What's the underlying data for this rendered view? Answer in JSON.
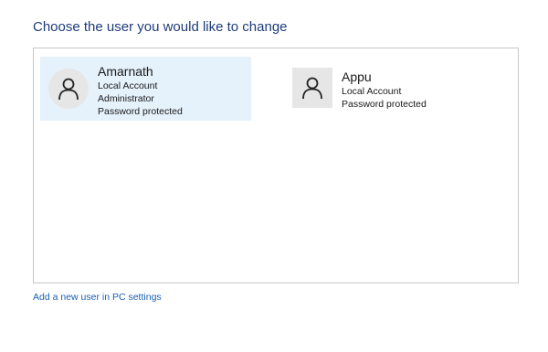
{
  "page": {
    "title": "Choose the user you would like to change",
    "add_user_link": "Add a new user in PC settings"
  },
  "users": [
    {
      "name": "Amarnath",
      "lines": [
        "Local Account",
        "Administrator",
        "Password protected"
      ],
      "selected": true,
      "icon": "user-icon"
    },
    {
      "name": "Appu",
      "lines": [
        "Local Account",
        "Password protected"
      ],
      "selected": false,
      "icon": "user-icon"
    }
  ],
  "colors": {
    "title": "#1e3c7a",
    "selected_bg": "#e5f1fb",
    "link": "#1a5fb4",
    "avatar_bg": "#e6e6e6"
  }
}
